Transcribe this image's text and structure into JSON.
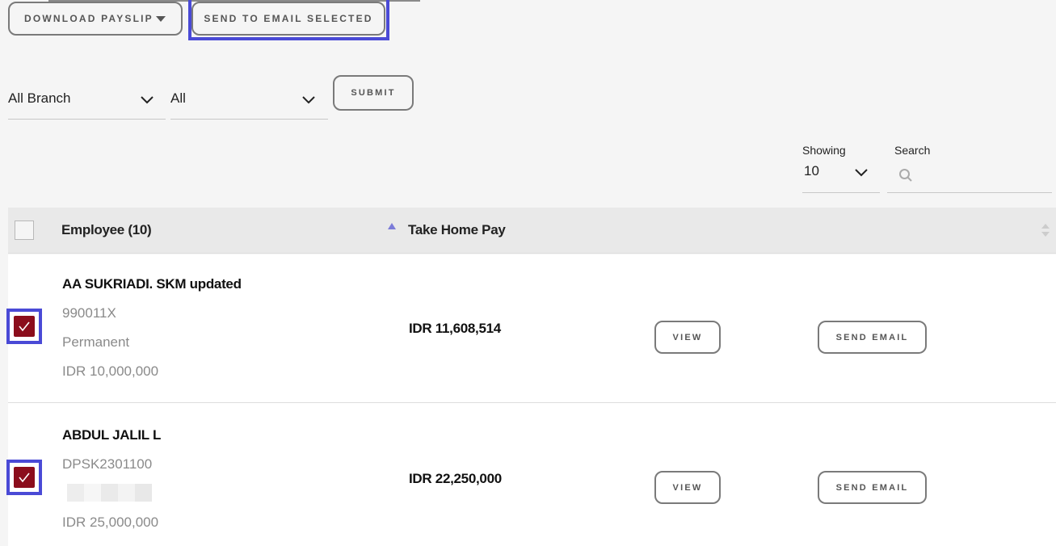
{
  "toolbar": {
    "download_payslip": "DOWNLOAD PAYSLIP",
    "send_to_email_selected": "SEND TO EMAIL SELECTED"
  },
  "filters": {
    "branch_value": "All Branch",
    "type_value": "All",
    "submit_label": "SUBMIT"
  },
  "pagination": {
    "showing_label": "Showing",
    "showing_value": "10",
    "search_label": "Search",
    "search_placeholder": ""
  },
  "table": {
    "col_employee": "Employee (10)",
    "col_take_home": "Take Home Pay",
    "rows": [
      {
        "name": "AA SUKRIADI. SKM updated",
        "id": "990011X",
        "status": "Permanent",
        "salary": "IDR 10,000,000",
        "take_home": "IDR 11,608,514",
        "checked": true,
        "view_label": "VIEW",
        "send_label": "SEND EMAIL"
      },
      {
        "name": "ABDUL JALIL L",
        "id": "DPSK2301100",
        "status": "",
        "salary": "IDR 25,000,000",
        "take_home": "IDR 22,250,000",
        "checked": true,
        "view_label": "VIEW",
        "send_label": "SEND EMAIL"
      }
    ]
  },
  "colors": {
    "checkbox_checked": "#8b0d1c",
    "highlight": "#4a4ad6",
    "sort_arrow": "#7b7bd8"
  }
}
